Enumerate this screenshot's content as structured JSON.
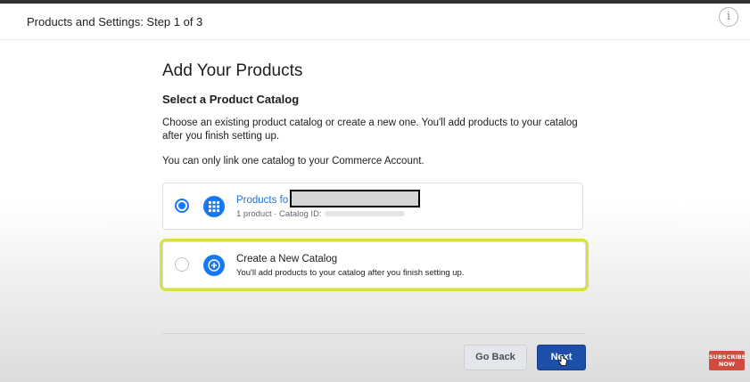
{
  "header": {
    "title": "Products and Settings: Step 1 of 3",
    "info_icon": "i"
  },
  "main": {
    "heading": "Add Your Products",
    "subheading": "Select a Product Catalog",
    "description": "Choose an existing product catalog or create a new one. You'll add products to your catalog after you finish setting up.",
    "note": "You can only link one catalog to your Commerce Account."
  },
  "options": [
    {
      "title": "Products fo",
      "subtitle": "1 product · Catalog ID:",
      "selected": true,
      "icon": "grid-icon"
    },
    {
      "title": "Create a New Catalog",
      "subtitle": "You'll add products to your catalog after you finish setting up.",
      "selected": false,
      "icon": "plus-icon"
    }
  ],
  "footer": {
    "back_label": "Go Back",
    "next_label": "Next"
  },
  "overlay": {
    "subscribe_line1": "SUBSCRIBE",
    "subscribe_line2": "NOW"
  },
  "colors": {
    "accent": "#1877f2",
    "highlight": "#d8e23a",
    "next_button": "#1d4fa8"
  }
}
